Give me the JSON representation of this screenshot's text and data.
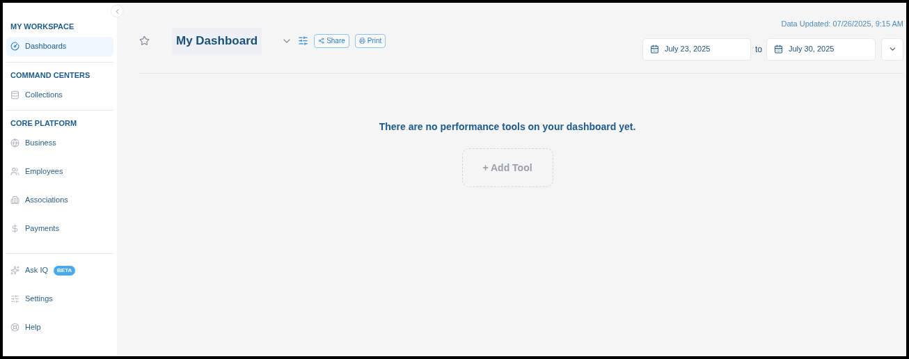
{
  "sidebar": {
    "sections": [
      {
        "title": "MY WORKSPACE",
        "items": [
          {
            "label": "Dashboards",
            "selected": true
          }
        ]
      },
      {
        "title": "COMMAND CENTERS",
        "items": [
          {
            "label": "Collections",
            "selected": false
          }
        ]
      },
      {
        "title": "CORE PLATFORM",
        "items": [
          {
            "label": "Business",
            "selected": false
          },
          {
            "label": "Employees",
            "selected": false
          },
          {
            "label": "Associations",
            "selected": false
          },
          {
            "label": "Payments",
            "selected": false
          }
        ]
      },
      {
        "items": [
          {
            "label": "Ask IQ",
            "selected": false,
            "badge": "BETA"
          },
          {
            "label": "Settings",
            "selected": false
          },
          {
            "label": "Help",
            "selected": false
          }
        ]
      }
    ]
  },
  "header": {
    "title": "My Dashboard",
    "starred": false,
    "buttons": [
      "Share",
      "Print"
    ],
    "data_updated": "Data Updated: 07/26/2025, 9:15 AM",
    "date_from": "July 23, 2025",
    "date_separator": "to",
    "date_to": "July 30, 2025"
  },
  "empty_state": {
    "message": "There are no performance tools on your dashboard yet.",
    "button": "+ Add Tool"
  }
}
